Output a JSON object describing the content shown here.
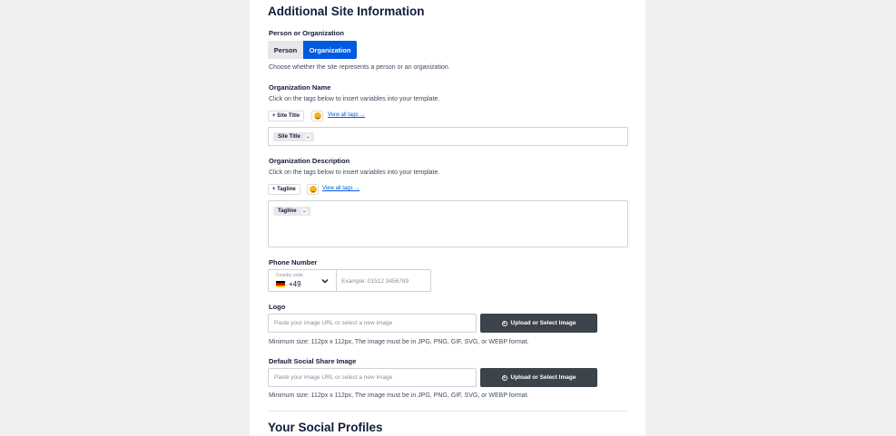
{
  "section_title": "Additional Site Information",
  "person_org": {
    "label": "Person or Organization",
    "options": [
      "Person",
      "Organization"
    ],
    "selected": "Organization",
    "help": "Choose whether the site represents a person or an organization."
  },
  "org_name": {
    "label": "Organization Name",
    "help": "Click on the tags below to insert variables into your template.",
    "tag_button": "+ Site Title",
    "view_all": "View all tags →",
    "chip": "Site Title"
  },
  "org_description": {
    "label": "Organization Description",
    "help": "Click on the tags below to insert variables into your template.",
    "tag_button": "+ Tagline",
    "view_all": "View all tags →",
    "chip": "Tagline"
  },
  "phone": {
    "label": "Phone Number",
    "country_label": "Country code",
    "country_code": "+49",
    "flag": "germany-flag-icon",
    "placeholder": "Example: 01512 3456789"
  },
  "logo": {
    "label": "Logo",
    "placeholder": "Paste your image URL or select a new image",
    "button": "Upload or Select Image",
    "help": "Minimum size: 112px x 112px, The image must be in JPG, PNG, GIF, SVG, or WEBP format."
  },
  "social_image": {
    "label": "Default Social Share Image",
    "placeholder": "Paste your image URL or select a new image",
    "button": "Upload or Select Image",
    "help": "Minimum size: 112px x 112px, The image must be in JPG, PNG, GIF, SVG, or WEBP format."
  },
  "next_section_title": "Your Social Profiles",
  "colors": {
    "accent": "#005ae0",
    "button_dark": "#3c434a",
    "text": "#141b38"
  }
}
